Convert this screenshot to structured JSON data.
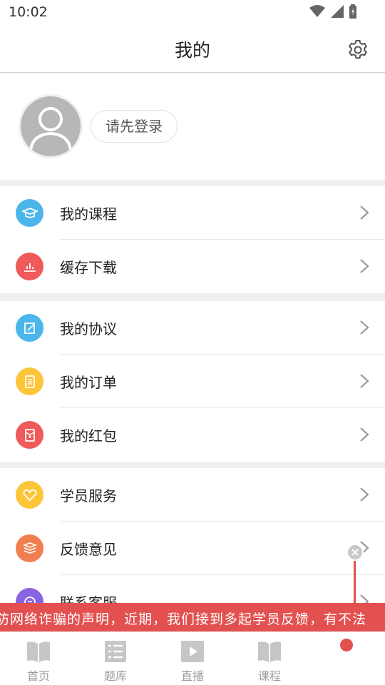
{
  "status_bar": {
    "time": "10:02"
  },
  "header": {
    "title": "我的"
  },
  "profile": {
    "login_label": "请先登录"
  },
  "menu_groups": [
    {
      "items": [
        {
          "id": "courses",
          "label": "我的课程",
          "icon": "graduation-cap-icon",
          "color": "#4bb6ea"
        },
        {
          "id": "downloads",
          "label": "缓存下载",
          "icon": "download-chart-icon",
          "color": "#ef5a5a"
        }
      ]
    },
    {
      "items": [
        {
          "id": "agreement",
          "label": "我的协议",
          "icon": "edit-document-icon",
          "color": "#4bb6ea"
        },
        {
          "id": "orders",
          "label": "我的订单",
          "icon": "order-list-icon",
          "color": "#fcc53a"
        },
        {
          "id": "redpacket",
          "label": "我的红包",
          "icon": "red-packet-icon",
          "color": "#ef5a5a"
        }
      ]
    },
    {
      "items": [
        {
          "id": "student_service",
          "label": "学员服务",
          "icon": "heart-icon",
          "color": "#fcc53a"
        },
        {
          "id": "feedback",
          "label": "反馈意见",
          "icon": "stack-icon",
          "color": "#ef7f50"
        },
        {
          "id": "contact",
          "label": "联系客服",
          "icon": "chat-icon",
          "color": "#8a63e0"
        }
      ]
    }
  ],
  "banner": {
    "text": "防网络诈骗的声明，近期，我们接到多起学员反馈，有不法"
  },
  "tabs": [
    {
      "id": "home",
      "label": "首页",
      "icon": "book-icon"
    },
    {
      "id": "question_bank",
      "label": "题库",
      "icon": "list-icon"
    },
    {
      "id": "live",
      "label": "直播",
      "icon": "play-icon"
    },
    {
      "id": "course",
      "label": "课程",
      "icon": "book-icon"
    }
  ],
  "colors": {
    "accent": "#e35050",
    "tab_inactive": "#9a9a9a"
  }
}
